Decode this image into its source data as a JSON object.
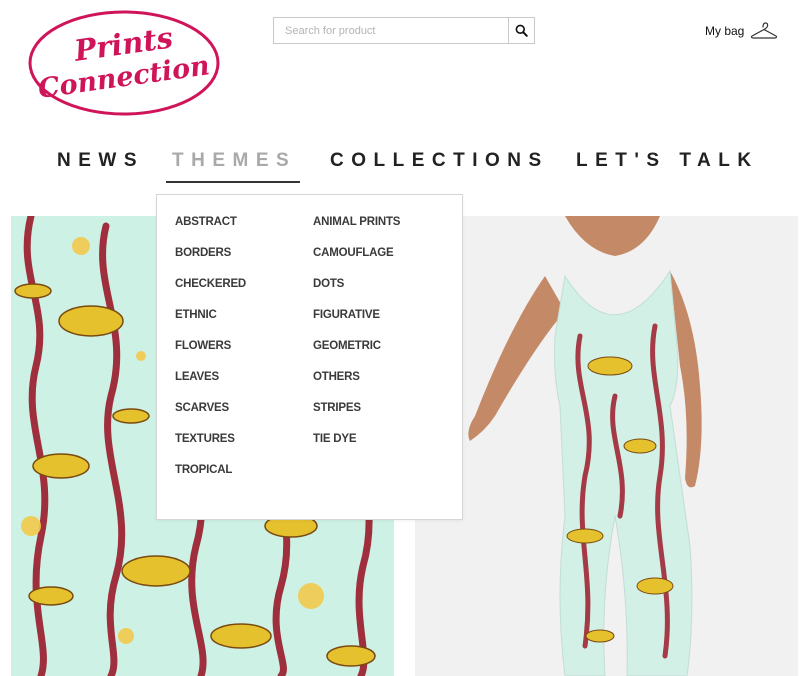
{
  "brand": {
    "line1": "Prints",
    "line2": "Connection",
    "color": "#d0145a"
  },
  "search": {
    "placeholder": "Search for product",
    "icon": "search-icon"
  },
  "bag": {
    "label": "My bag",
    "icon": "hanger-icon"
  },
  "nav": {
    "items": [
      {
        "label": "NEWS"
      },
      {
        "label": "THEMES",
        "active": true
      },
      {
        "label": "COLLECTIONS"
      },
      {
        "label": "LET'S TALK"
      }
    ]
  },
  "themes_menu": {
    "column1": [
      "ABSTRACT",
      "BORDERS",
      "CHECKERED",
      "ETHNIC",
      "FLOWERS",
      "LEAVES",
      "SCARVES",
      "TEXTURES",
      "TROPICAL"
    ],
    "column2": [
      "ANIMAL PRINTS",
      "CAMOUFLAGE",
      "DOTS",
      "FIGURATIVE",
      "GEOMETRIC",
      "OTHERS",
      "STRIPES",
      "TIE DYE"
    ]
  },
  "colors": {
    "accent": "#d0145a",
    "pattern_bg": "#cdf2e5",
    "seaweed": "#9b1b2a",
    "fish": "#e6c12e"
  }
}
